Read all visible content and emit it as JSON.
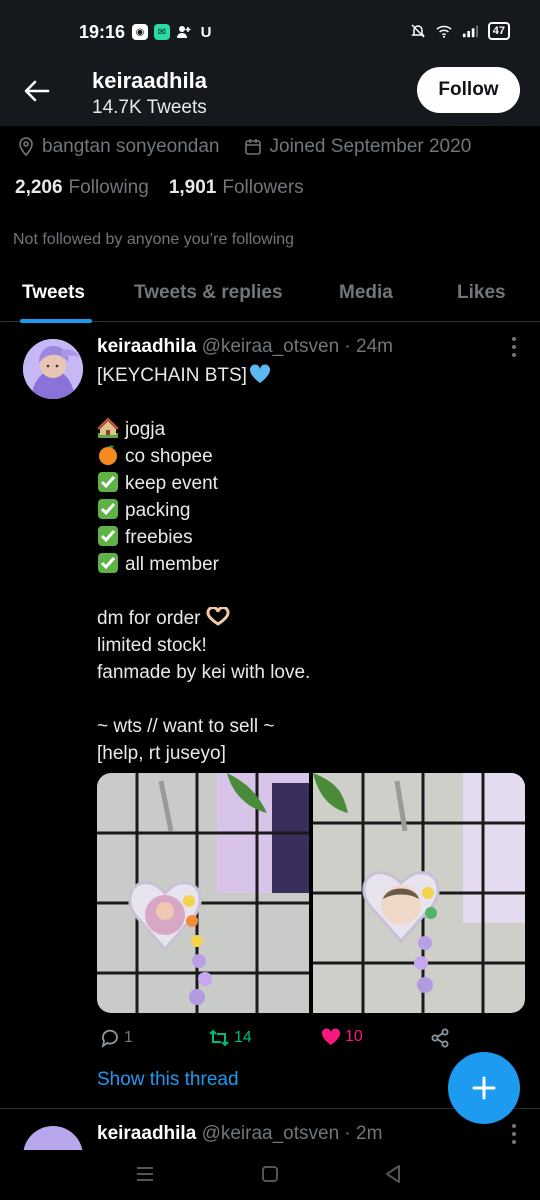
{
  "status_bar": {
    "time": "19:16",
    "battery": "47",
    "left_icons": [
      "app-icon",
      "chat-icon",
      "add-user-icon",
      "u-icon"
    ],
    "right_icons": [
      "mute-icon",
      "wifi-icon",
      "signal-icon"
    ]
  },
  "header": {
    "name": "keiraadhila",
    "tweets_count": "14.7K Tweets",
    "follow_label": "Follow"
  },
  "profile": {
    "location": "bangtan sonyeondan",
    "joined": "Joined September 2020",
    "following_count": "2,206",
    "following_label": "Following",
    "followers_count": "1,901",
    "followers_label": "Followers",
    "not_followed": "Not followed by anyone you’re following"
  },
  "tabs": [
    {
      "label": "Tweets",
      "active": true
    },
    {
      "label": "Tweets & replies",
      "active": false
    },
    {
      "label": "Media",
      "active": false
    },
    {
      "label": "Likes",
      "active": false
    }
  ],
  "tweet": {
    "name": "keiraadhila",
    "handle_time": "@keiraa_otsven · 24m",
    "lines": {
      "l1": "[KEYCHAIN BTS]",
      "l3": "jogja",
      "l4": "co shopee",
      "l5": "keep event",
      "l6": "packing",
      "l7": "freebies",
      "l8": "all member",
      "l10": "dm for order",
      "l11": "limited stock!",
      "l12": "fanmade by kei with love.",
      "l14": "~ wts // want to sell ~",
      "l15": "[help, rt juseyo]"
    },
    "replies": "1",
    "retweets": "14",
    "likes": "10",
    "show_thread": "Show this thread",
    "colors": {
      "retweet": "#00ba7c",
      "like": "#f91880",
      "link": "#1d9bf0"
    }
  },
  "tweet2": {
    "name": "keiraadhila",
    "handle_time": "@keiraa_otsven · 2m"
  },
  "nav": {
    "icons": [
      "menu-icon",
      "home-square-icon",
      "back-triangle-icon"
    ]
  }
}
